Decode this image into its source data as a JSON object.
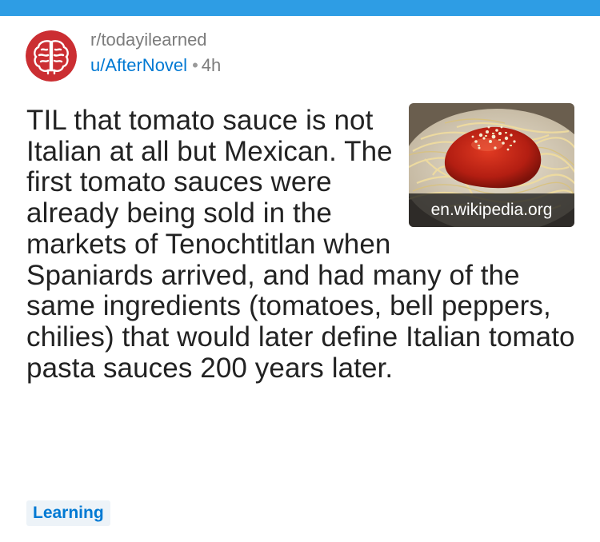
{
  "colors": {
    "top_bar": "#2e9de4",
    "avatar_bg": "#cb2e32",
    "link_blue": "#0079d3",
    "meta_gray": "#7c7c7c",
    "title_text": "#222222",
    "flair_bg": "#edf3f8"
  },
  "post": {
    "subreddit": "r/todayilearned",
    "author": "u/AfterNovel",
    "separator": "•",
    "age": "4h",
    "subreddit_icon": "brain-icon",
    "title": "TIL that tomato sauce is not Italian at all but Mexican. The first tomato sauces were already being sold in the markets of Tenochtitlan when Spaniards arrived, and had many of the same ingredients (tomatoes, bell peppers, chilies) that would later define Italian tomato pasta sauces 200 years later.",
    "thumbnail": {
      "domain": "en.wikipedia.org"
    },
    "flair": "Learning"
  }
}
